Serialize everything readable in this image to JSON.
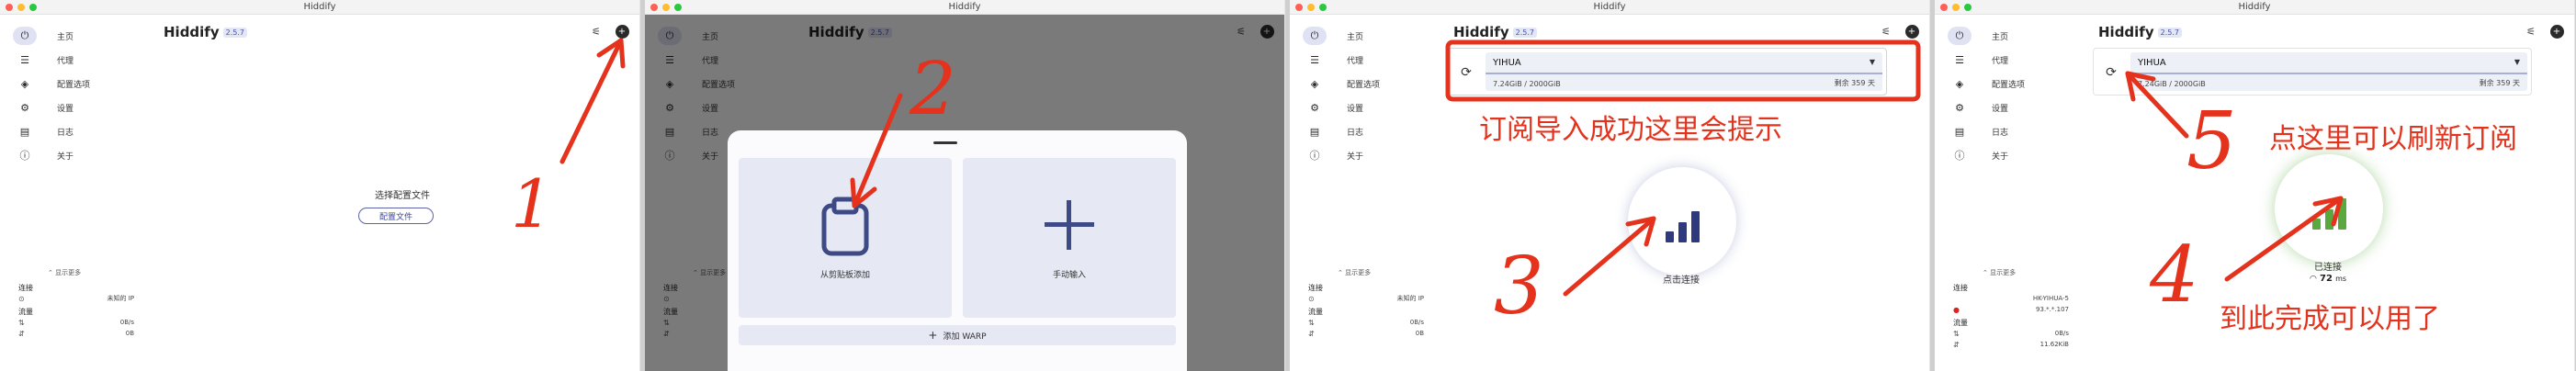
{
  "window": {
    "title": "Hiddify"
  },
  "app": {
    "name": "Hiddify",
    "version": "2.5.7"
  },
  "sidebar": {
    "items": [
      {
        "label": "主页",
        "icon": "power-icon"
      },
      {
        "label": "代理",
        "icon": "filter-icon"
      },
      {
        "label": "配置选项",
        "icon": "layers-icon"
      },
      {
        "label": "设置",
        "icon": "gear-icon"
      },
      {
        "label": "日志",
        "icon": "document-icon"
      },
      {
        "label": "关于",
        "icon": "info-icon"
      }
    ]
  },
  "home_empty": {
    "title": "选择配置文件",
    "button": "配置文件"
  },
  "stats": {
    "show_more": "显示更多",
    "connection_label": "连接",
    "unknown_ip": "未知的 IP",
    "traffic_label": "流量",
    "up_rate": "0B/s",
    "down_total": "0B",
    "connected_location": "HK-YIHUA-5",
    "connected_ip": "93.*.*.107",
    "down_total_connected": "11.62KiB"
  },
  "add_sheet": {
    "clipboard": "从剪贴板添加",
    "manual": "手动输入",
    "warp": "添加 WARP"
  },
  "profile": {
    "name": "YIHUA",
    "usage": "7.24GiB / 2000GiB",
    "remaining": "剩余 359 天"
  },
  "connect": {
    "tap_to_connect": "点击连接",
    "connected": "已连接",
    "ping_value": "72",
    "ping_unit": "ms"
  },
  "annotations": {
    "n1": "1",
    "n2": "2",
    "n3": "3",
    "n4": "4",
    "n5": "5",
    "import_success": "订阅导入成功这里会提示",
    "refresh_hint": "点这里可以刷新订阅",
    "done_hint": "到此完成可以用了"
  },
  "colors": {
    "annotation_red": "#e4321c",
    "accent": "#3d4a85",
    "connected_green": "#5aa83e",
    "disconnected_navy": "#2f3a7e"
  }
}
